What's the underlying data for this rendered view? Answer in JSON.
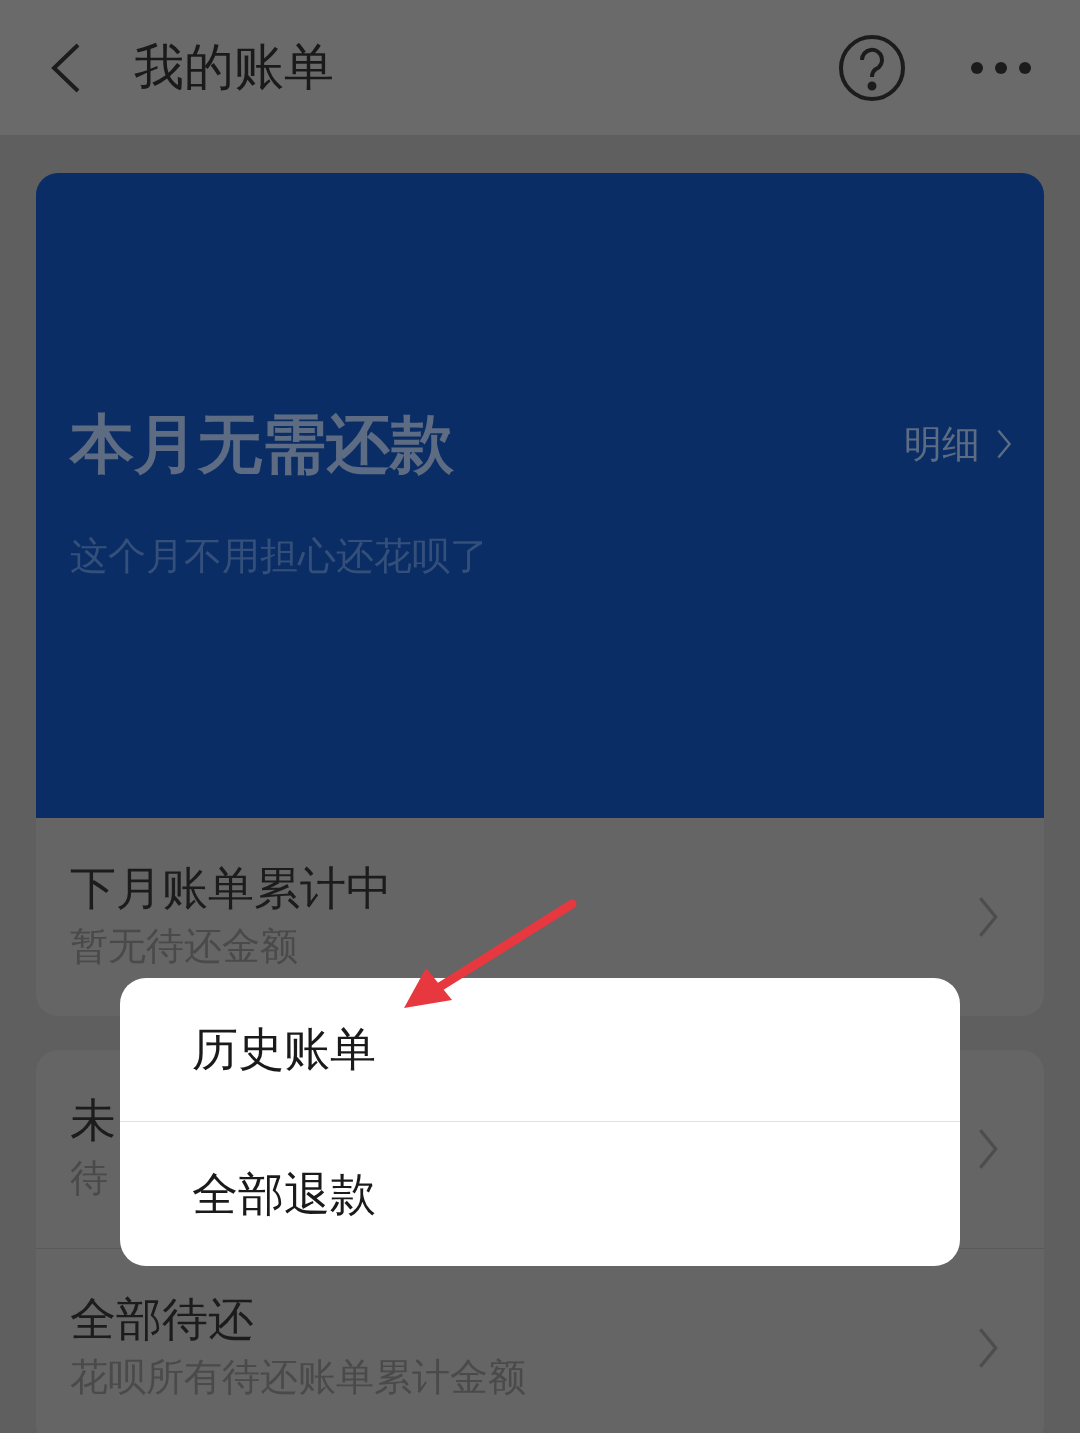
{
  "header": {
    "title": "我的账单"
  },
  "banner": {
    "title": "本月无需还款",
    "subtitle": "这个月不用担心还花呗了",
    "link": "明细"
  },
  "cards": [
    {
      "rows": [
        {
          "title": "下月账单累计中",
          "subtitle": "暂无待还金额"
        }
      ]
    },
    {
      "rows": [
        {
          "title": "未",
          "subtitle": "待"
        },
        {
          "title": "全部待还",
          "subtitle": "花呗所有待还账单累计金额"
        }
      ]
    }
  ],
  "menu": {
    "items": [
      {
        "label": "历史账单"
      },
      {
        "label": "全部退款"
      }
    ]
  }
}
